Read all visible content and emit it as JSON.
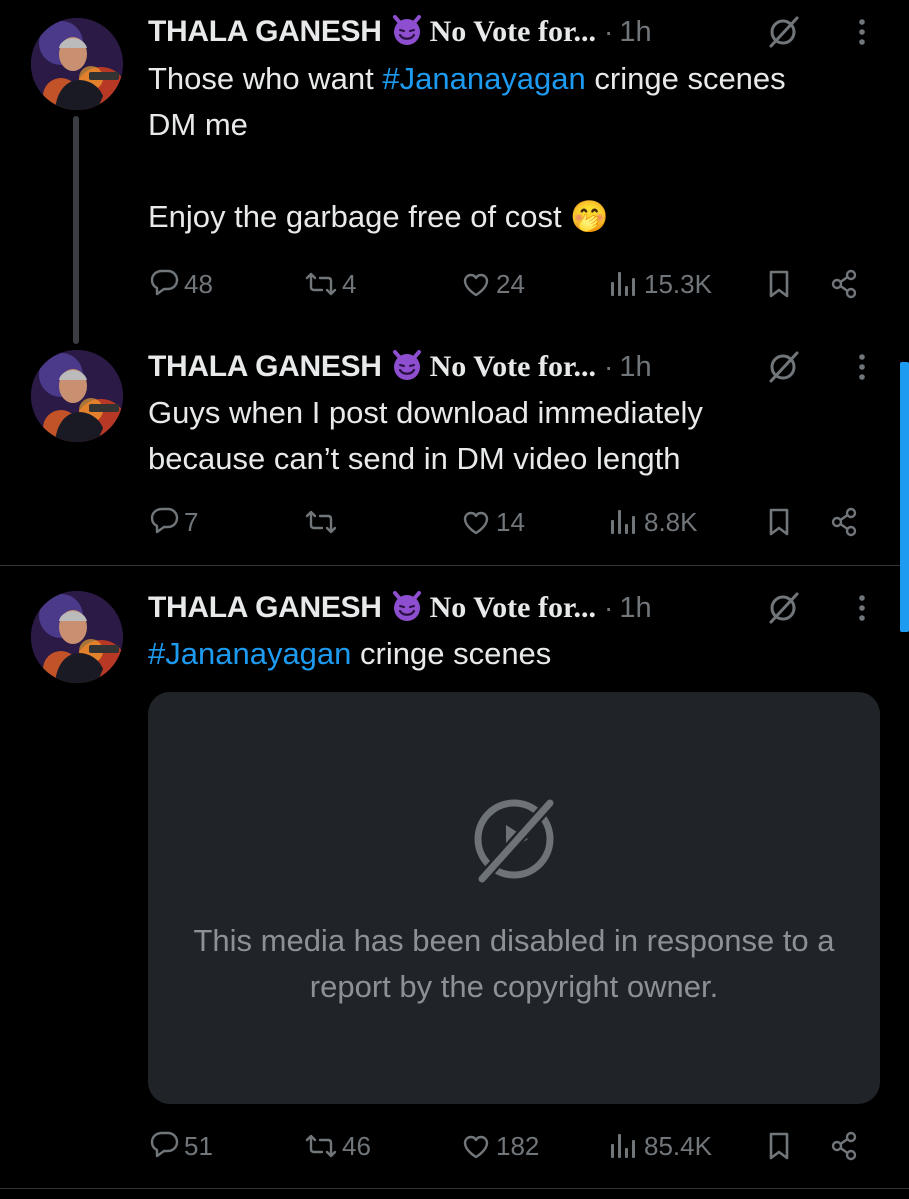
{
  "tweets": [
    {
      "author_name": "THALA GANESH",
      "author_emoji": "😈",
      "author_suffix": "No Vote for...",
      "dot": "·",
      "time": "1h",
      "text_pre": "Those who want ",
      "hashtag": "#Jananayagan",
      "text_post": " cringe scenes DM me",
      "text_line2": "Enjoy the garbage free of cost 🤭",
      "replies": "48",
      "reposts": "4",
      "likes": "24",
      "views": "15.3K"
    },
    {
      "author_name": "THALA GANESH",
      "author_emoji": "😈",
      "author_suffix": "No Vote for...",
      "dot": "·",
      "time": "1h",
      "text": "Guys when I post download immediately because can’t send in DM video length",
      "replies": "7",
      "reposts": "",
      "likes": "14",
      "views": "8.8K"
    },
    {
      "author_name": "THALA GANESH",
      "author_emoji": "😈",
      "author_suffix": "No Vote for...",
      "dot": "·",
      "time": "1h",
      "hashtag": "#Jananayagan",
      "text_post": " cringe scenes",
      "media_message": "This media has been disabled in response to a report by the copyright owner.",
      "replies": "51",
      "reposts": "46",
      "likes": "182",
      "views": "85.4K"
    }
  ],
  "colors": {
    "background": "#000000",
    "text": "#e7e9ea",
    "muted": "#71767b",
    "link": "#1d9bf0",
    "media_bg": "#202327"
  },
  "icons": [
    "reply-icon",
    "repost-icon",
    "like-icon",
    "views-icon",
    "bookmark-icon",
    "share-icon",
    "grok-icon",
    "more-icon",
    "media-disabled-icon"
  ]
}
